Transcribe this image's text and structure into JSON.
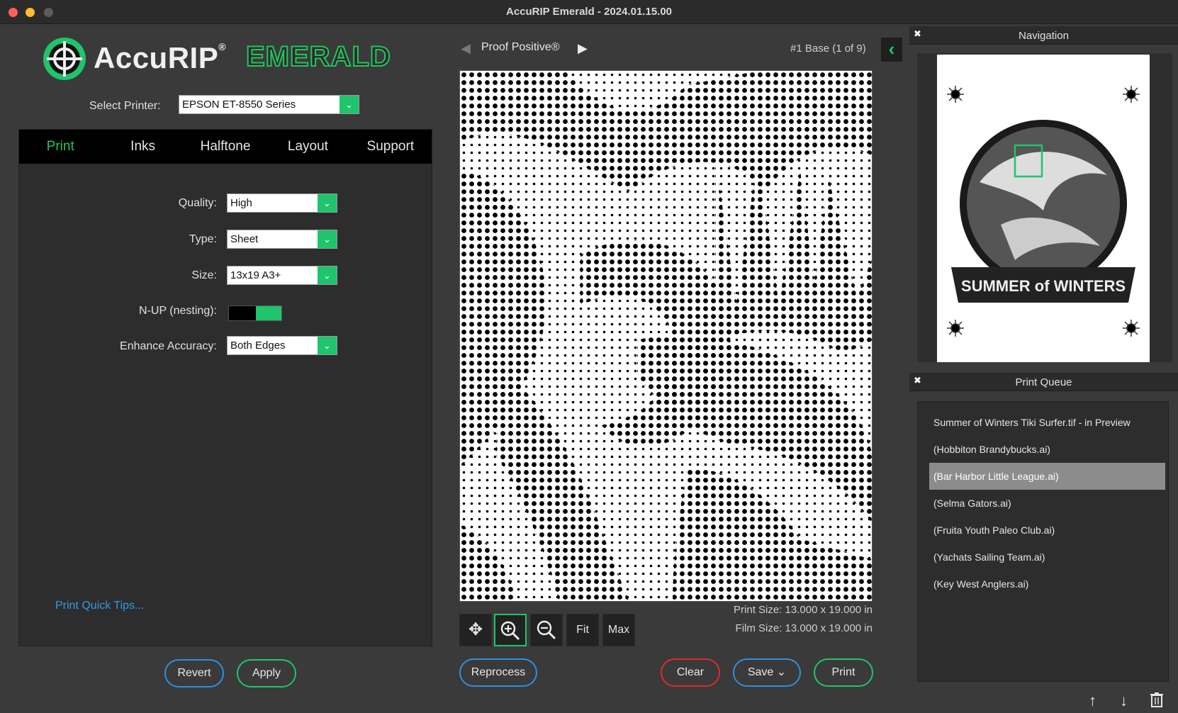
{
  "window": {
    "title": "AccuRIP Emerald - 2024.01.15.00"
  },
  "logo": {
    "brand": "AccuRIP",
    "reg": "®",
    "edition": "EMERALD"
  },
  "printer": {
    "label": "Select Printer:",
    "value": "EPSON ET-8550 Series"
  },
  "tabs": [
    {
      "label": "Print",
      "active": true
    },
    {
      "label": "Inks"
    },
    {
      "label": "Halftone"
    },
    {
      "label": "Layout"
    },
    {
      "label": "Support"
    }
  ],
  "print_settings": {
    "quality": {
      "label": "Quality:",
      "value": "High"
    },
    "type": {
      "label": "Type:",
      "value": "Sheet"
    },
    "size": {
      "label": "Size:",
      "value": "13x19 A3+"
    },
    "nup": {
      "label": "N-UP (nesting):",
      "enabled": true
    },
    "enhance": {
      "label": "Enhance Accuracy:",
      "value": "Both Edges"
    },
    "quick_tips": "Print Quick Tips..."
  },
  "left_buttons": {
    "revert": "Revert",
    "apply": "Apply"
  },
  "preview": {
    "mode": "Proof Positive®",
    "plate": "#1 Base (1 of 9)",
    "print_size": "Print Size: 13.000 x 19.000  in",
    "film_size": "Film Size: 13.000 x 19.000  in"
  },
  "tools": {
    "fit": "Fit",
    "max": "Max"
  },
  "center_buttons": {
    "reprocess": "Reprocess",
    "clear": "Clear",
    "save": "Save ⌄",
    "print": "Print"
  },
  "navigation": {
    "title": "Navigation",
    "artwork_text": "SUMMER of WINTERS"
  },
  "queue": {
    "title": "Print Queue",
    "items": [
      "Summer of Winters Tiki Surfer.tif - in Preview",
      "(Hobbiton Brandybucks.ai)",
      "(Bar Harbor Little League.ai)",
      "(Selma Gators.ai)",
      "(Fruita Youth Paleo Club.ai)",
      "(Yachats Sailing Team.ai)",
      "(Key West Anglers.ai)"
    ],
    "selected_index": 2
  },
  "colors": {
    "accent": "#1fc46c",
    "link": "#2f9be8",
    "danger": "#e02a2a",
    "button_blue": "#2f8fe0"
  }
}
